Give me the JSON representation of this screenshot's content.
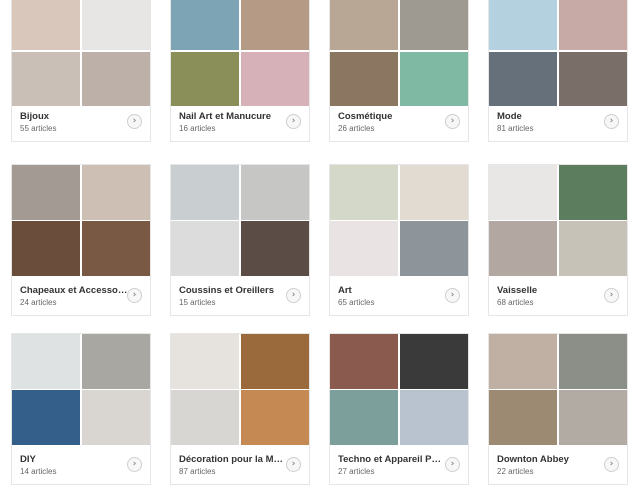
{
  "cards": [
    {
      "title": "Bijoux",
      "count": "55 articles",
      "arrow": "›",
      "tiles": [
        "#d9c7bc",
        "#e8e6e4",
        "#c9bfb6",
        "#bdb0a8"
      ]
    },
    {
      "title": "Nail Art et Manucure",
      "count": "16 articles",
      "arrow": "›",
      "tiles": [
        "#7da4b4",
        "#b59a86",
        "#8a8f5a",
        "#d6b2b8"
      ]
    },
    {
      "title": "Cosmétique",
      "count": "26 articles",
      "arrow": "›",
      "tiles": [
        "#b9a795",
        "#9f9a91",
        "#8a7661",
        "#7fb8a3"
      ]
    },
    {
      "title": "Mode",
      "count": "81 articles",
      "arrow": "›",
      "tiles": [
        "#b3d1de",
        "#c7a9a6",
        "#66707a",
        "#7a6f68"
      ]
    },
    {
      "title": "Chapeaux et Accessoires",
      "count": "24 articles",
      "arrow": "›",
      "tiles": [
        "#a39a93",
        "#cdbfb4",
        "#6a4d3a",
        "#7a5944"
      ]
    },
    {
      "title": "Coussins et Oreillers",
      "count": "15 articles",
      "arrow": "›",
      "tiles": [
        "#c9ced1",
        "#c6c7c5",
        "#dcdcdc",
        "#5b4d45"
      ]
    },
    {
      "title": "Art",
      "count": "65 articles",
      "arrow": "›",
      "tiles": [
        "#d4d8c8",
        "#e2dbd2",
        "#e9e4e3",
        "#8d959a"
      ]
    },
    {
      "title": "Vaisselle",
      "count": "68 articles",
      "arrow": "›",
      "tiles": [
        "#e9e7e6",
        "#5c7d5e",
        "#b3a8a1",
        "#c7c2b8"
      ]
    },
    {
      "title": "DIY",
      "count": "14 articles",
      "arrow": "›",
      "tiles": [
        "#dfe2e2",
        "#a8a7a2",
        "#335f8a",
        "#d9d6d1"
      ]
    },
    {
      "title": "Décoration pour la Maison",
      "count": "87 articles",
      "arrow": "›",
      "tiles": [
        "#e6e2dd",
        "#9b6a3c",
        "#d8d6d3",
        "#c58a54"
      ]
    },
    {
      "title": "Techno et Appareil Photo",
      "count": "27 articles",
      "arrow": "›",
      "tiles": [
        "#8b5a4e",
        "#3a3a3a",
        "#7c9f9b",
        "#b8c3cf"
      ]
    },
    {
      "title": "Downton Abbey",
      "count": "22 articles",
      "arrow": "›",
      "tiles": [
        "#bfb0a3",
        "#8c8f88",
        "#9c8a73",
        "#b2aba3"
      ]
    }
  ]
}
